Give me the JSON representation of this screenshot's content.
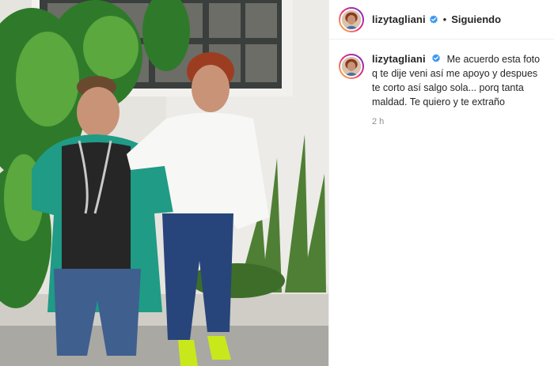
{
  "post": {
    "author": {
      "username": "lizytagliani",
      "verified": true
    },
    "header": {
      "separator": "•",
      "follow_status": "Siguiendo"
    },
    "caption": {
      "text": "Me acuerdo esta foto q te dije veni así me apoyo y despues te corto así salgo sola... porq tanta maldad. Te quiero y te extraño",
      "time": "2 h"
    },
    "colors": {
      "verified_badge": "#3897f0",
      "meta_text": "#8e8e8e"
    }
  }
}
